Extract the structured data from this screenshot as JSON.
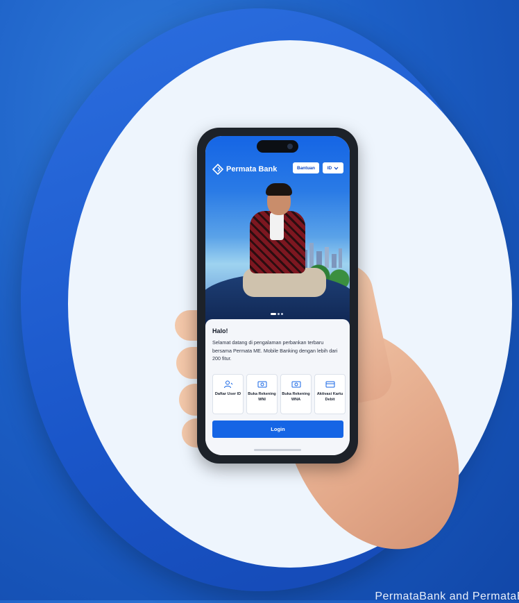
{
  "background": {
    "caption": "PermataBank and PermataB"
  },
  "app": {
    "brand": "Permata Bank",
    "help_label": "Bantuan",
    "language": "ID"
  },
  "welcome": {
    "greeting": "Halo!",
    "message": "Selamat datang di pengalaman perbankan terbaru bersama Permata ME. Mobile Banking dengan lebih dari 200 fitur."
  },
  "tiles": [
    {
      "label": "Daftar User ID",
      "icon": "user-add-icon"
    },
    {
      "label": "Buka Rekening WNI",
      "icon": "money-icon"
    },
    {
      "label": "Buka Rekening WNA",
      "icon": "money-icon"
    },
    {
      "label": "Aktivasi Kartu Debit",
      "icon": "card-icon"
    }
  ],
  "carousel": {
    "count": 3,
    "active": 1
  },
  "login_label": "Login",
  "colors": {
    "brand_blue": "#1565e5",
    "background_blue": "#1c5fc6",
    "oval": "#eef5fd"
  }
}
